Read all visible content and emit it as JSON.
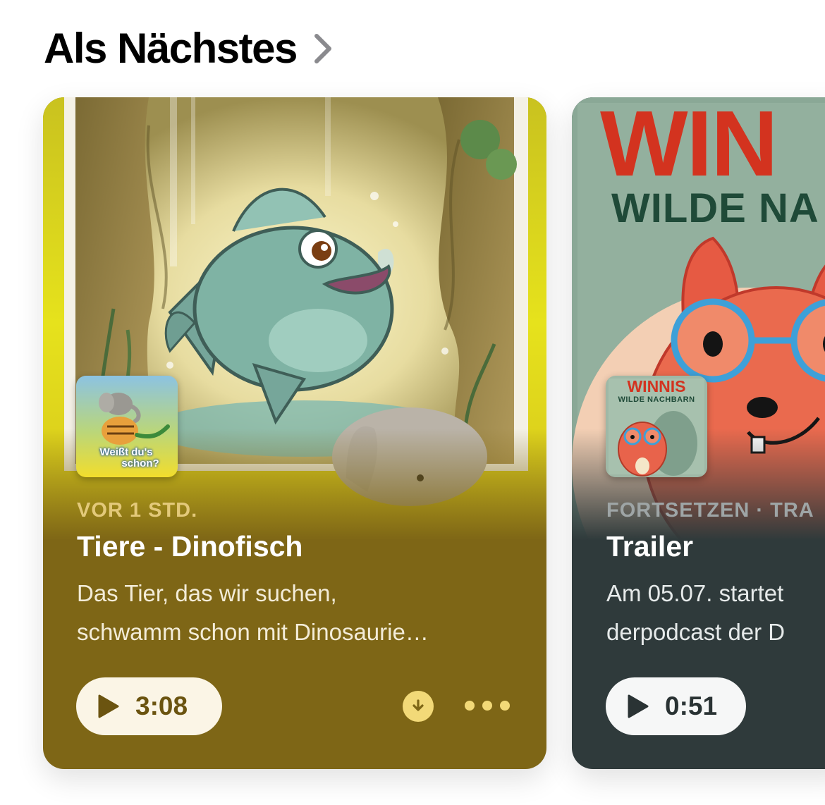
{
  "section": {
    "title": "Als Nächstes",
    "chevron_icon": "chevron-right-icon"
  },
  "cards": [
    {
      "podcast_artwork": "Weißt du's schon?",
      "thumb_text_line1": "Weißt du's",
      "thumb_text_line2": "schon?",
      "meta": "VOR 1 STD.",
      "title": "Tiere - Dinofisch",
      "desc_line1": "Das Tier, das wir suchen,",
      "desc_line2": "schwamm schon mit Dinosaurie…",
      "duration": "3:08",
      "background_color": "#7e6616",
      "accent_color": "#f2d978",
      "icons": [
        "play-icon",
        "download-icon",
        "more-icon"
      ]
    },
    {
      "podcast_artwork": "Winnis Wilde Nachbarn",
      "art_title_line1": "WIN",
      "art_title_line2": "WILDE NA",
      "thumb_title_line1": "WINNIS",
      "thumb_title_line2": "WILDE NACHBARN",
      "meta": "FORTSETZEN · TRA",
      "title": "Trailer",
      "desc_line1": "Am 05.07. startet",
      "desc_line2": "derpodcast der D",
      "duration": "0:51",
      "background_color": "#2f3a3b",
      "icons": [
        "play-icon"
      ]
    }
  ]
}
